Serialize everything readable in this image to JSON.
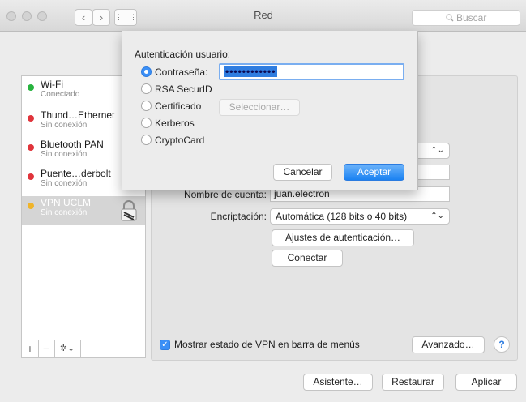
{
  "window": {
    "title": "Red",
    "search_placeholder": "Buscar",
    "nav_back": "‹",
    "nav_forward": "›",
    "grid_glyph": "⋮⋮⋮"
  },
  "sidebar": {
    "items": [
      {
        "name": "Wi-Fi",
        "status": "Conectado",
        "dot_color": "#28b33f"
      },
      {
        "name": "Thund…Ethernet",
        "status": "Sin conexión",
        "dot_color": "#e0343b"
      },
      {
        "name": "Bluetooth PAN",
        "status": "Sin conexión",
        "dot_color": "#e0343b"
      },
      {
        "name": "Puente…derbolt",
        "status": "Sin conexión",
        "dot_color": "#e0343b"
      },
      {
        "name": "VPN UCLM",
        "status": "Sin conexión",
        "dot_color": "#f0b429",
        "icon": "vpn-lock-icon"
      }
    ],
    "add_label": "+",
    "remove_label": "−",
    "action_label": "✲⌄"
  },
  "settings": {
    "account_label": "Nombre de cuenta:",
    "account_value": "juan.electron",
    "encryption_label": "Encriptación:",
    "encryption_value": "Automática (128 bits o 40 bits)",
    "auth_settings_button": "Ajustes de autenticación…",
    "connect_button": "Conectar",
    "show_vpn_status_label": "Mostrar estado de VPN en barra de menús",
    "show_vpn_status_checked": true,
    "advanced_button": "Avanzado…",
    "help_label": "?"
  },
  "footer": {
    "assistant_button": "Asistente…",
    "restore_button": "Restaurar",
    "apply_button": "Aplicar"
  },
  "auth_sheet": {
    "title": "Autenticación usuario:",
    "options": [
      {
        "label": "Contraseña:",
        "selected": true
      },
      {
        "label": "RSA SecurID",
        "selected": false
      },
      {
        "label": "Certificado",
        "selected": false
      },
      {
        "label": "Kerberos",
        "selected": false
      },
      {
        "label": "CryptoCard",
        "selected": false
      }
    ],
    "password_mask": "••••••••••••",
    "select_button": "Seleccionar…",
    "cancel_button": "Cancelar",
    "accept_button": "Aceptar"
  },
  "colors": {
    "accent": "#1b82f2",
    "selection_highlight": "#3b8ff6"
  }
}
